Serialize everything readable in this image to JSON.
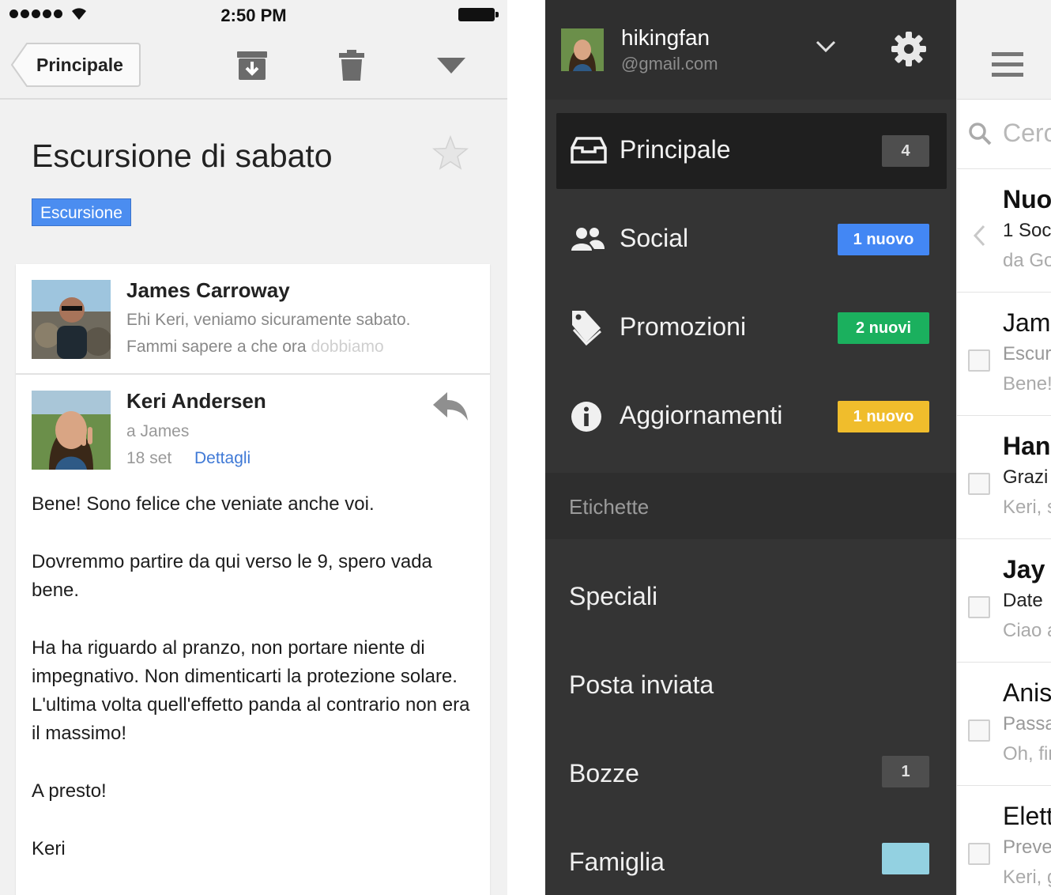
{
  "status_bar": {
    "time": "2:50 PM"
  },
  "toolbar": {
    "back_label": "Principale"
  },
  "thread": {
    "subject": "Escursione di sabato",
    "label": "Escursione",
    "messages": [
      {
        "sender": "James Carroway",
        "preview_1": "Ehi Keri, veniamo sicuramente sabato.",
        "preview_2": "Fammi sapere a che ora",
        "preview_2_faded": "dobbiamo"
      },
      {
        "sender": "Keri Andersen",
        "to": "a James",
        "date": "18 set",
        "details": "Dettagli"
      }
    ],
    "body": [
      "Bene! Sono felice che veniate anche voi.",
      "Dovremmo partire da qui verso le 9, spero vada bene.",
      "Ha ha riguardo al pranzo, non portare niente di impegnativo.  Non dimenticarti la protezione solare. L'ultima volta quell'effetto panda al contrario non era il massimo!",
      "A presto!",
      "Keri"
    ]
  },
  "drawer": {
    "account_name": "hikingfan",
    "account_domain": "@gmail.com",
    "categories": [
      {
        "label": "Principale",
        "badge": "4",
        "badge_color": "#4e4e4e"
      },
      {
        "label": "Social",
        "badge": "1 nuovo",
        "badge_color": "#4387f4"
      },
      {
        "label": "Promozioni",
        "badge": "2 nuovi",
        "badge_color": "#1bb05e"
      },
      {
        "label": "Aggiornamenti",
        "badge": "1 nuovo",
        "badge_color": "#f0bd2c"
      }
    ],
    "labels_header": "Etichette",
    "labels": [
      {
        "label": "Speciali"
      },
      {
        "label": "Posta inviata"
      },
      {
        "label": "Bozze",
        "badge": "1"
      },
      {
        "label": "Famiglia",
        "swatch_color": "#93d1e1"
      }
    ]
  },
  "inbox_peek": {
    "search_placeholder": "Cerc",
    "rows": [
      {
        "title": "Nuo",
        "line2": "1 Soc",
        "line3": "da Go"
      },
      {
        "title": "Jam",
        "line2": "Escur",
        "line3": "Bene!"
      },
      {
        "title": "Han",
        "line2": "Grazi",
        "line3": "Keri, s"
      },
      {
        "title": "Jay",
        "line2": "Date",
        "line3": "Ciao a"
      },
      {
        "title": "Anis",
        "line2": "Passa",
        "line3": "Oh, fir"
      },
      {
        "title": "Elett",
        "line2": "Preve",
        "line3": "Keri, g"
      }
    ]
  },
  "colors": {
    "accent_blue": "#4b8df0",
    "drawer_bg": "#343434",
    "link": "#3f79d6"
  }
}
